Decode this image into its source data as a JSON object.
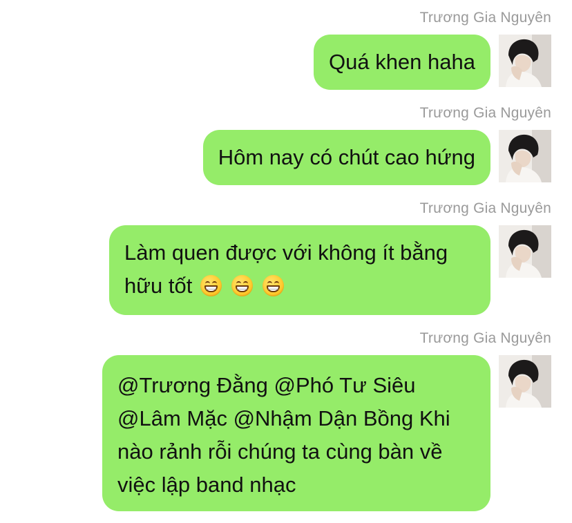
{
  "chat": {
    "messages": [
      {
        "sender": "Trương Gia Nguyên",
        "lines": [
          "Quá khen haha"
        ],
        "emoji_count": 0
      },
      {
        "sender": "Trương Gia Nguyên",
        "lines": [
          "Hôm nay có chút cao hứng"
        ],
        "emoji_count": 0
      },
      {
        "sender": "Trương Gia Nguyên",
        "lines": [
          "Làm quen được với không ít bằng",
          "hữu tốt"
        ],
        "emoji": "grinning-face-with-smiling-eyes",
        "emoji_count": 3
      },
      {
        "sender": "Trương Gia Nguyên",
        "lines": [
          "@Trương Đằng @Phó Tư Siêu",
          "@Lâm Mặc @Nhậm Dận Bồng Khi",
          "nào rảnh rỗi chúng ta cùng bàn về",
          "việc lập band nhạc"
        ],
        "emoji_count": 0
      }
    ]
  },
  "colors": {
    "bubble": "#95ec69",
    "sender_name": "#9a9a9a",
    "text": "#111111",
    "background": "#ffffff"
  }
}
